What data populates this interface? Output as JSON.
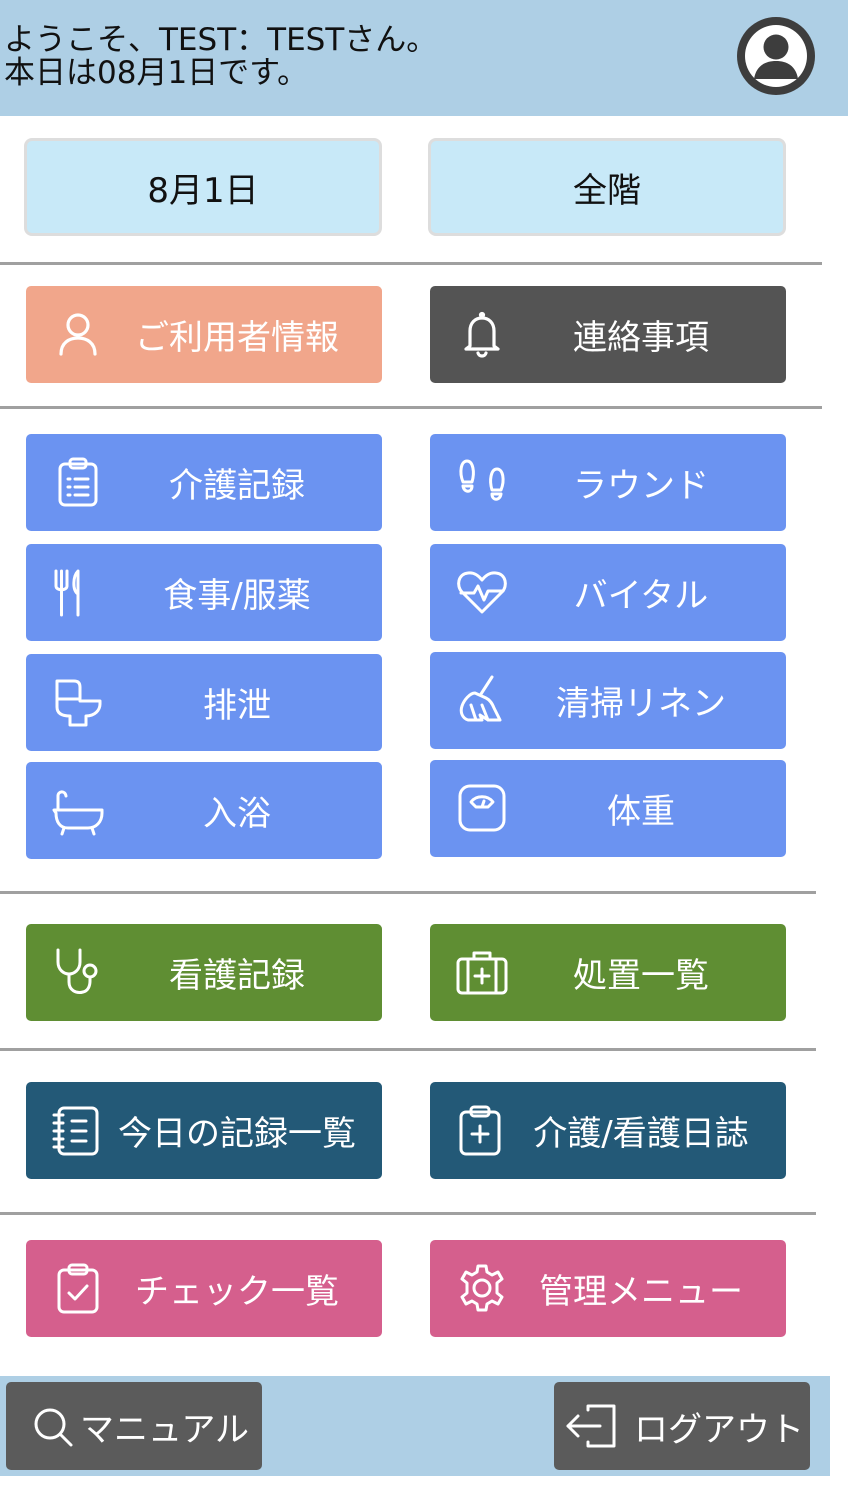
{
  "header": {
    "greeting_line1": "ようこそ、TEST：TESTさん。",
    "greeting_line2": "本日は08月1日です。",
    "avatar_icon": "user-avatar-icon"
  },
  "selectors": {
    "date": "8月1日",
    "floor": "全階"
  },
  "buttons": {
    "user_info": "ご利用者情報",
    "notices": "連絡事項",
    "care_record": "介護記録",
    "round": "ラウンド",
    "meal_medication": "食事/服薬",
    "vital": "バイタル",
    "excretion": "排泄",
    "cleaning_linen": "清掃リネン",
    "bathing": "入浴",
    "weight": "体重",
    "nursing_record": "看護記録",
    "treatment_list": "処置一覧",
    "today_records": "今日の記録一覧",
    "care_nursing_diary": "介護/看護日誌",
    "check_list": "チェック一覧",
    "admin_menu": "管理メニュー"
  },
  "footer": {
    "manual": "マニュアル",
    "logout": "ログアウト"
  },
  "colors": {
    "header_bg": "#aecfe5",
    "selector_bg": "#c8e9f8",
    "user_info": "#f1a68b",
    "notices": "#545454",
    "care": "#6b93f1",
    "nursing": "#5f8e33",
    "records": "#235977",
    "check": "#d55f8d",
    "footer_btn": "#5b5b5b"
  }
}
